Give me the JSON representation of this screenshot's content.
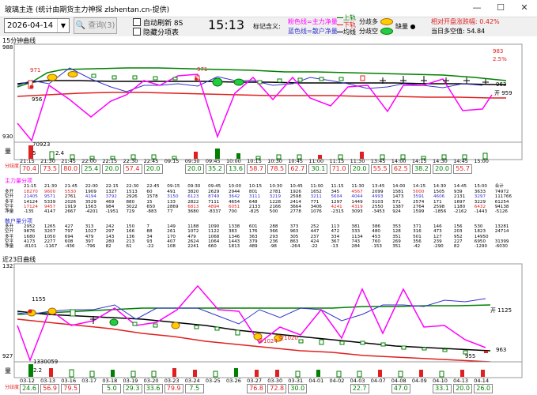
{
  "window": {
    "title": "玻璃主连 (统计由期货主力神探 zlshentan.cn-提供)",
    "minimize": "—",
    "maximize": "☐",
    "close": "✕"
  },
  "toolbar": {
    "date": "2026-04-14",
    "query_label": "查询(3)",
    "auto_refresh_label": "自动刷新 8S",
    "hide_table_label": "隐藏分项表",
    "time": "15:13",
    "legend_title": "标记含义:",
    "legend_pink": "粉色线=主力净量",
    "legend_blue": "蓝色线=散户净量",
    "legend_up": "上轨",
    "legend_down": "下轨",
    "legend_mid": "均线",
    "legend_long": "分歧多",
    "legend_short": "分歧空",
    "legend_missing": "缺量",
    "pct_label": "相对开盘涨跌幅: 0.42%",
    "oi_label": "当日多空值: 54.84"
  },
  "panel15": {
    "title": "15分钟曲线",
    "ymax": "988",
    "ymin": "930",
    "price_tags": [
      "971",
      "971",
      "956"
    ],
    "right_high": "983",
    "right_pct": "2.5%",
    "right_963": "963",
    "open_label": "开 959",
    "vol_label": "量",
    "vol_values": [
      "70923",
      "5",
      "2.4"
    ],
    "diverge_label": "分歧度",
    "times": [
      "21:15",
      "21:30",
      "21:45",
      "22:00",
      "22:15",
      "22:30",
      "22:45",
      "09:15",
      "09:30",
      "09:45",
      "10:00",
      "10:15",
      "10:30",
      "10:45",
      "11:00",
      "11:15",
      "11:30",
      "13:45",
      "14:00",
      "14:15",
      "14:30",
      "14:45",
      "15:00"
    ],
    "diverge": [
      "70.4",
      "73.5",
      "80.0",
      "25.4",
      "20.0",
      "57.4",
      "20.0",
      "",
      "20.0",
      "35.2",
      "13.6",
      "58.7",
      "78.5",
      "62.7",
      "30.1",
      "71.0",
      "20.0",
      "55.5",
      "62.5",
      "38.2",
      "20.0",
      "55.7"
    ]
  },
  "main_table": {
    "title": "主力量分项",
    "header": [
      "",
      "21:15",
      "21:30",
      "21:45",
      "22:00",
      "22:15",
      "22:30",
      "22:45",
      "09:15",
      "09:30",
      "09:45",
      "10:00",
      "10:15",
      "10:30",
      "10:45",
      "11:00",
      "11:15",
      "11:30",
      "13:45",
      "14:00",
      "14:15",
      "14:30",
      "14:45",
      "15:00",
      "合计"
    ],
    "rows": [
      [
        "多开",
        "18270",
        "9600",
        "5530",
        "1909",
        "1327",
        "1513",
        "60",
        "491",
        "3820",
        "2629",
        "2944",
        "801",
        "2781",
        "1926",
        "1652",
        "345",
        "4567",
        "2099",
        "1581",
        "5000",
        "1505",
        "939",
        "3633",
        "74972"
      ],
      [
        "空开",
        "21405",
        "9571",
        "2761",
        "4194",
        "3792",
        "2926",
        "1578",
        "3150",
        "6123",
        "8749",
        "3642",
        "3111",
        "3219",
        "2598",
        "3211",
        "5604",
        "4044",
        "4993",
        "1473",
        "3591",
        "4606",
        "2131",
        "3297",
        "111766"
      ],
      [
        "多平",
        "14124",
        "5339",
        "2026",
        "3529",
        "469",
        "880",
        "15",
        "133",
        "2822",
        "7111",
        "4654",
        "648",
        "1228",
        "2414",
        "771",
        "1297",
        "1449",
        "3103",
        "571",
        "2574",
        "171",
        "1697",
        "3229",
        "61254"
      ],
      [
        "空平",
        "17124",
        "9457",
        "1919",
        "1563",
        "984",
        "3022",
        "650",
        "2869",
        "6813",
        "4894",
        "6051",
        "2133",
        "2166",
        "3664",
        "3406",
        "4241",
        "4319",
        "2550",
        "1387",
        "2764",
        "2598",
        "1180",
        "6432",
        "94138"
      ],
      [
        "净量",
        "-135",
        "4147",
        "2667",
        "-4201",
        "-1951",
        "729",
        "-883",
        "77",
        "3680",
        "-8337",
        "700",
        "-825",
        "500",
        "2778",
        "1076",
        "-2315",
        "3093",
        "-3453",
        "924",
        "1599",
        "-1856",
        "-2162",
        "-1443",
        "-5126"
      ]
    ]
  },
  "retail_table": {
    "title": "散户量分项",
    "rows": [
      [
        "多开",
        "2952",
        "1265",
        "427",
        "313",
        "242",
        "150",
        "7",
        "149",
        "1188",
        "1090",
        "1338",
        "601",
        "288",
        "373",
        "252",
        "113",
        "381",
        "386",
        "353",
        "371",
        "146",
        "156",
        "530",
        "13281"
      ],
      [
        "空开",
        "9876",
        "3207",
        "797",
        "1027",
        "297",
        "166",
        "88",
        "261",
        "1072",
        "1122",
        "383",
        "176",
        "366",
        "963",
        "447",
        "472",
        "333",
        "480",
        "128",
        "316",
        "473",
        "203",
        "1823",
        "24714"
      ],
      [
        "多平",
        "1680",
        "1050",
        "694",
        "479",
        "143",
        "136",
        "34",
        "170",
        "479",
        "1068",
        "1346",
        "363",
        "293",
        "305",
        "237",
        "334",
        "1134",
        "453",
        "351",
        "501",
        "127",
        "952",
        "14950"
      ],
      [
        "空平",
        "4173",
        "2277",
        "608",
        "397",
        "280",
        "213",
        "93",
        "407",
        "2624",
        "1064",
        "1443",
        "379",
        "236",
        "863",
        "424",
        "367",
        "743",
        "760",
        "269",
        "356",
        "239",
        "227",
        "6950",
        "31399"
      ],
      [
        "净量",
        "-8101",
        "-1167",
        "-436",
        "-796",
        "82",
        "61",
        "-22",
        "108",
        "2241",
        "660",
        "1813",
        "489",
        "-98",
        "-264",
        "-22",
        "-13",
        "284",
        "-153",
        "351",
        "-42",
        "-290",
        "82",
        "-1290",
        "-6030"
      ]
    ]
  },
  "panel23": {
    "title": "近23日曲线",
    "ymax": "1323",
    "ymin": "927",
    "tag_1155": "1155",
    "right_1125": "开 1125",
    "right_963": "963",
    "tag_955": "955",
    "tag_1024": "多1024",
    "tag_1020": "空1020",
    "vol_label": "量",
    "vol_values": [
      "1330059",
      "2.2"
    ],
    "diverge_label": "分歧度",
    "dates": [
      "03-12",
      "03-13",
      "03-16",
      "03-17",
      "03-18",
      "03-19",
      "03-20",
      "03-23",
      "03-24",
      "03-25",
      "03-26",
      "03-27",
      "03-30",
      "03-31",
      "04-01",
      "04-02",
      "04-03",
      "04-07",
      "04-08",
      "04-09",
      "04-10",
      "04-13",
      "04-14"
    ],
    "diverge": [
      "24.6",
      "56.9",
      "79.5",
      "",
      "5.0",
      "29.3",
      "33.6",
      "79.9",
      "7.5",
      "",
      "",
      "76.8",
      "72.8",
      "30.0",
      "",
      "",
      "22.7",
      "",
      "47.0",
      "",
      "33.1",
      "20.0",
      "26.0"
    ]
  },
  "colors": {
    "pink": "#ff00ff",
    "blue": "#3333cc",
    "red": "#e02020",
    "green": "#008000",
    "black": "#000000",
    "orange": "#ff8c00"
  }
}
